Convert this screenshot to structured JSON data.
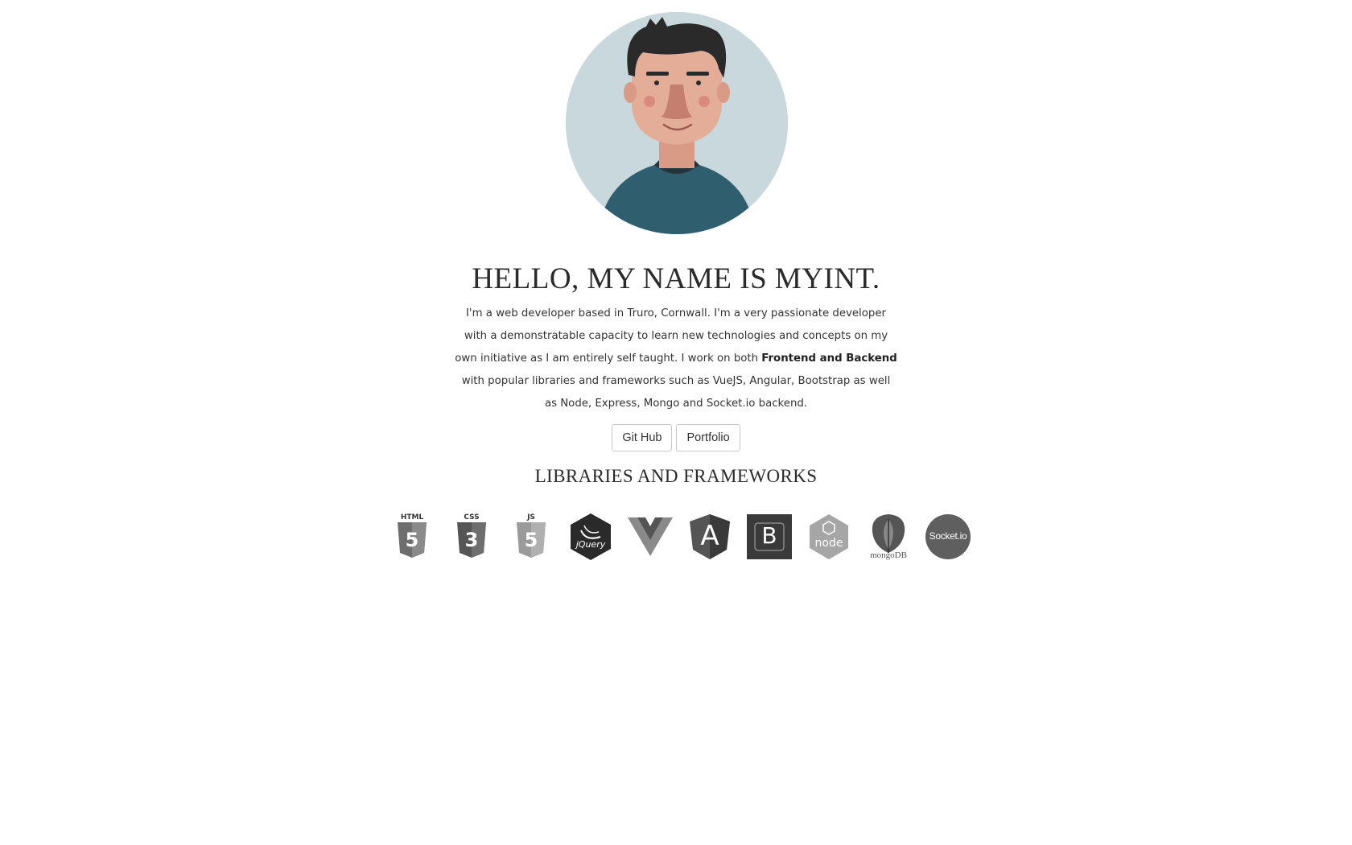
{
  "profile": {
    "avatar_icon": "developer-avatar-illustration",
    "title": "HELLO, MY NAME IS MYINT.",
    "bio_part1": "I'm a web developer based in Truro, Cornwall. I'm a very passionate developer with a demonstratable capacity to learn new technologies and concepts on my own initiative as I am entirely self taught. I work on both ",
    "bio_bold": "Frontend and Backend",
    "bio_part2": " with popular libraries and frameworks such as VueJS, Angular, Bootstrap as well as Node, Express, Mongo and Socket.io backend."
  },
  "buttons": {
    "github_label": "Git Hub",
    "portfolio_label": "Portfolio"
  },
  "libraries": {
    "title": "LIBRARIES AND FRAMEWORKS",
    "items": [
      {
        "name": "html5-icon",
        "label": "HTML",
        "glyph": "5"
      },
      {
        "name": "css3-icon",
        "label": "CSS",
        "glyph": "3"
      },
      {
        "name": "javascript-icon",
        "label": "JS",
        "glyph": "5"
      },
      {
        "name": "jquery-icon",
        "label": "jQuery"
      },
      {
        "name": "vuejs-icon"
      },
      {
        "name": "angular-icon",
        "glyph": "A"
      },
      {
        "name": "bootstrap-icon",
        "glyph": "B"
      },
      {
        "name": "nodejs-icon",
        "label": "node"
      },
      {
        "name": "mongodb-icon",
        "label": "mongoDB"
      },
      {
        "name": "socketio-icon",
        "label": "Socket.io"
      }
    ]
  },
  "colors": {
    "avatar_bg": "#c9d8dc",
    "shirt": "#2f5f6e",
    "hair": "#2a2a2a",
    "skin": "#dba28d",
    "logo_dark": "#3a3a3a",
    "logo_mid": "#6e6e6e",
    "logo_light": "#9a9a9a"
  }
}
